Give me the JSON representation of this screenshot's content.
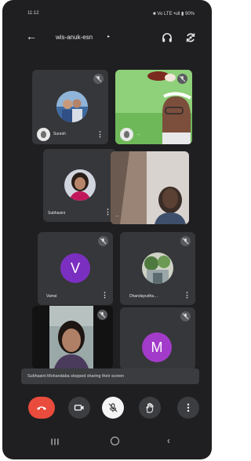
{
  "status_bar": {
    "time": "11:12",
    "indicators": "■ Vo LTE •ull ▮ 90%"
  },
  "header": {
    "title": "wis-anuk-esn",
    "caret": "▸",
    "back_icon": "arrow-left-icon",
    "audio_icon": "headphones-icon",
    "camera_switch_icon": "camera-flip-icon"
  },
  "participants": [
    {
      "name": "Suresh",
      "avatar": "photo",
      "muted": true
    },
    {
      "name": "…",
      "avatar": "video",
      "muted": true
    },
    {
      "name": "Subhasini",
      "avatar": "photo",
      "muted": false
    },
    {
      "name": "…",
      "avatar": "video",
      "muted": false
    },
    {
      "name": "Vamsi",
      "avatar": "letter",
      "letter": "V",
      "color": "#7b2fc0",
      "muted": true
    },
    {
      "name": "Dhandayudha…",
      "avatar": "photo",
      "muted": true
    },
    {
      "name": "",
      "avatar": "video",
      "muted": true
    },
    {
      "name": "",
      "avatar": "letter",
      "letter": "M",
      "color": "#a23bc9",
      "muted": true
    }
  ],
  "toast": {
    "text": "Subhasini Mohandaba stopped sharing their screen"
  },
  "controls": [
    {
      "name": "end-call",
      "icon": "phone-hangup-icon",
      "color": "#e94b3c"
    },
    {
      "name": "camera",
      "icon": "video-camera-icon"
    },
    {
      "name": "microphone",
      "icon": "mic-off-icon"
    },
    {
      "name": "raise-hand",
      "icon": "hand-icon"
    },
    {
      "name": "more",
      "icon": "more-vertical-icon"
    }
  ],
  "menu_glyph": "⋮",
  "nav": {
    "back": "‹",
    "recents_icon": "recents-icon",
    "home_icon": "home-circle-icon"
  }
}
